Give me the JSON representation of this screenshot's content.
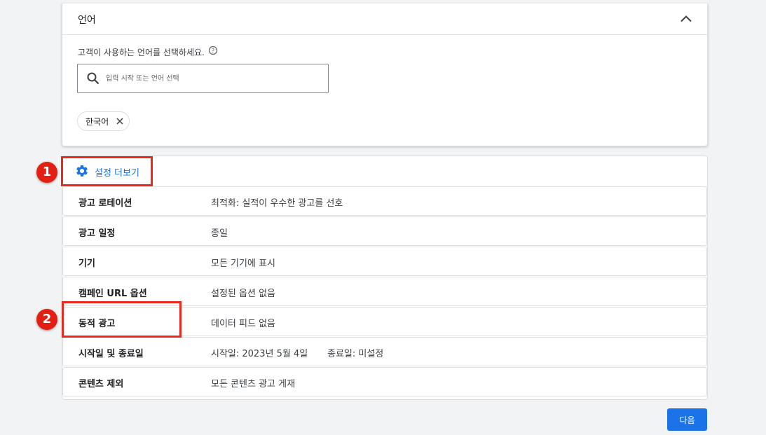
{
  "language_section": {
    "title": "언어",
    "description": "고객이 사용하는 언어를 선택하세요.",
    "search_placeholder": "입력 시작 또는 언어 선택",
    "selected_languages": [
      "한국어"
    ]
  },
  "settings": {
    "more_settings_label": "설정 더보기",
    "rows": [
      {
        "label": "광고 로테이션",
        "value": "최적화: 실적이 우수한 광고를 선호"
      },
      {
        "label": "광고 일정",
        "value": "종일"
      },
      {
        "label": "기기",
        "value": "모든 기기에 표시"
      },
      {
        "label": "캠페인 URL 옵션",
        "value": "설정된 옵션 없음"
      },
      {
        "label": "동적 광고",
        "value": "데이터 피드 없음"
      },
      {
        "label": "시작일 및 종료일",
        "value": "시작일: 2023년 5월 4일",
        "value2": "종료일: 미설정"
      },
      {
        "label": "콘텐츠 제외",
        "value": "모든 콘텐츠 광고 게재"
      }
    ]
  },
  "annotations": {
    "badge_1": "1",
    "badge_2": "2"
  },
  "actions": {
    "next_label": "다음"
  },
  "colors": {
    "accent": "#1a73e8",
    "annotation_red": "#e8291c",
    "background": "#f1f3f4"
  }
}
